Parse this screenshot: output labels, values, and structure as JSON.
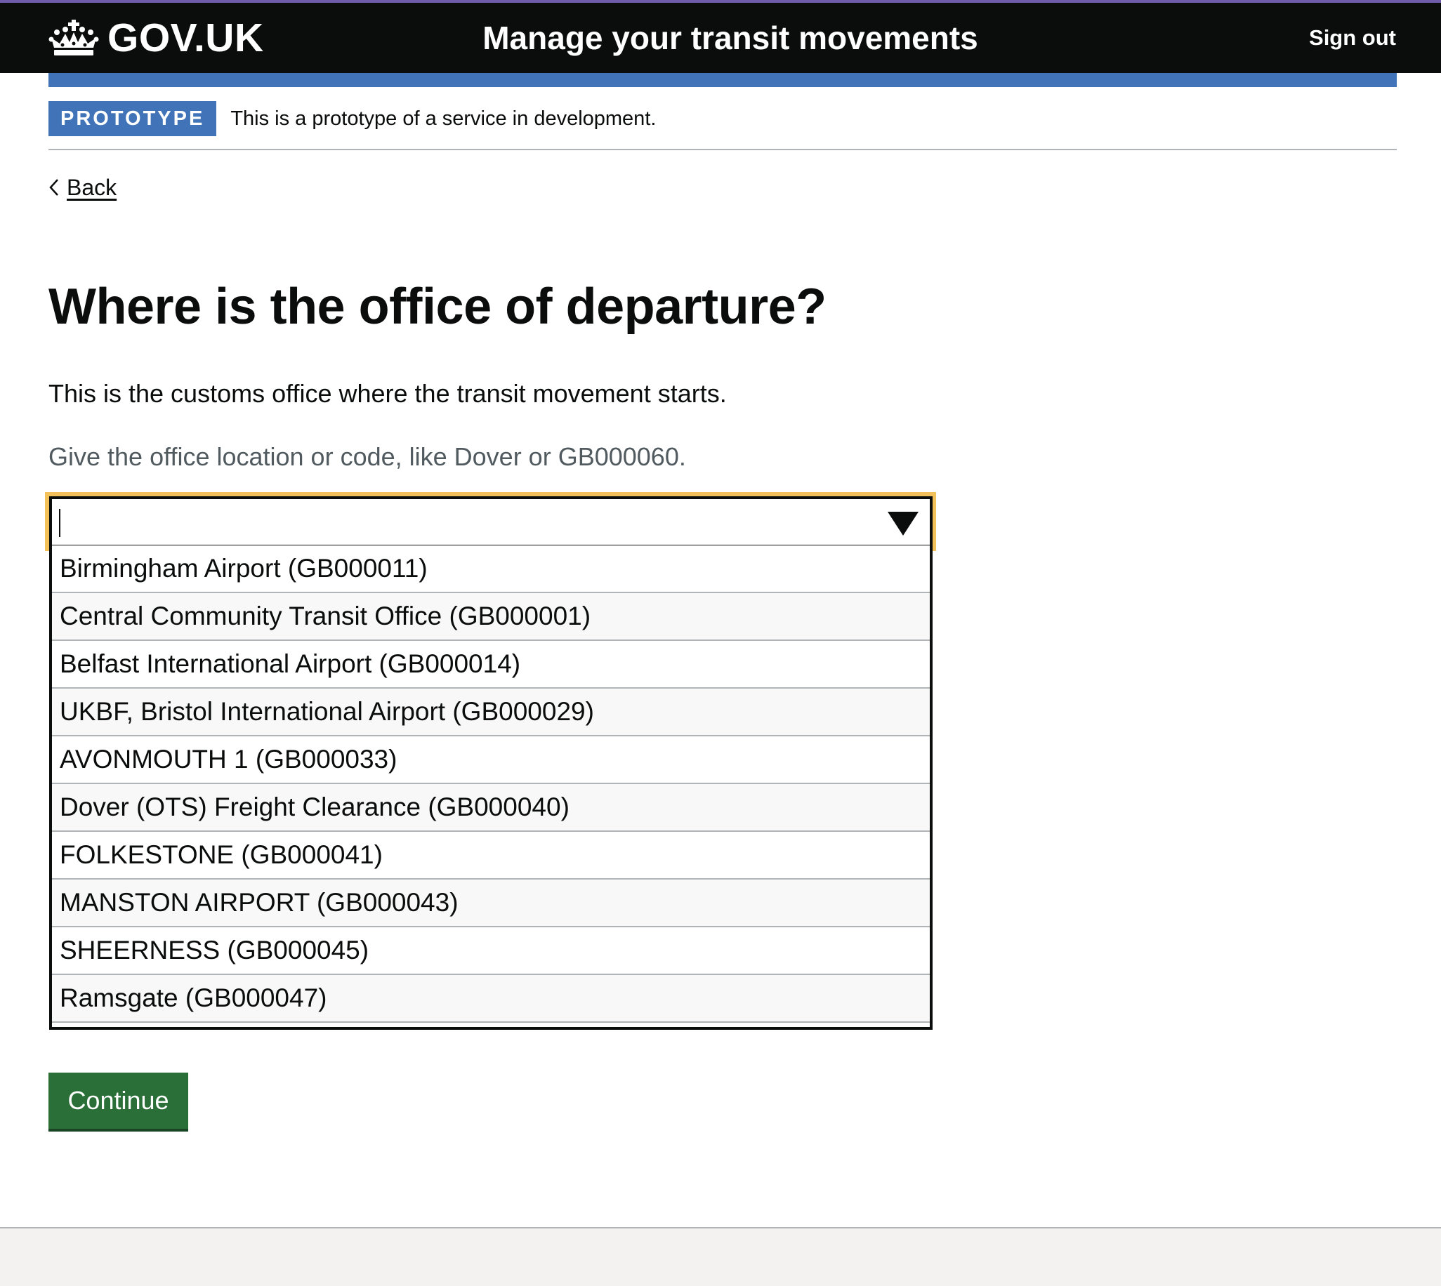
{
  "header": {
    "logo_text": "GOV.UK",
    "service_name": "Manage your transit movements",
    "sign_out": "Sign out"
  },
  "phase_banner": {
    "tag": "PROTOTYPE",
    "text": "This is a prototype of a service in development."
  },
  "back_link": "Back",
  "page": {
    "title": "Where is the office of departure?",
    "body": "This is the customs office where the transit movement starts.",
    "hint": "Give the office location or code, like Dover or GB000060."
  },
  "autocomplete": {
    "value": "",
    "options": [
      "Birmingham Airport (GB000011)",
      "Central Community Transit Office (GB000001)",
      "Belfast International Airport (GB000014)",
      "UKBF, Bristol International Airport (GB000029)",
      "AVONMOUTH 1 (GB000033)",
      "Dover (OTS) Freight Clearance (GB000040)",
      "FOLKESTONE (GB000041)",
      "MANSTON AIRPORT (GB000043)",
      "SHEERNESS (GB000045)",
      "Ramsgate (GB000047)"
    ]
  },
  "continue_button": "Continue",
  "colors": {
    "header_bg": "#0b0c0c",
    "brand_blue": "#4173b8",
    "focus": "#f3c15a",
    "button_green": "#2a6f38"
  }
}
